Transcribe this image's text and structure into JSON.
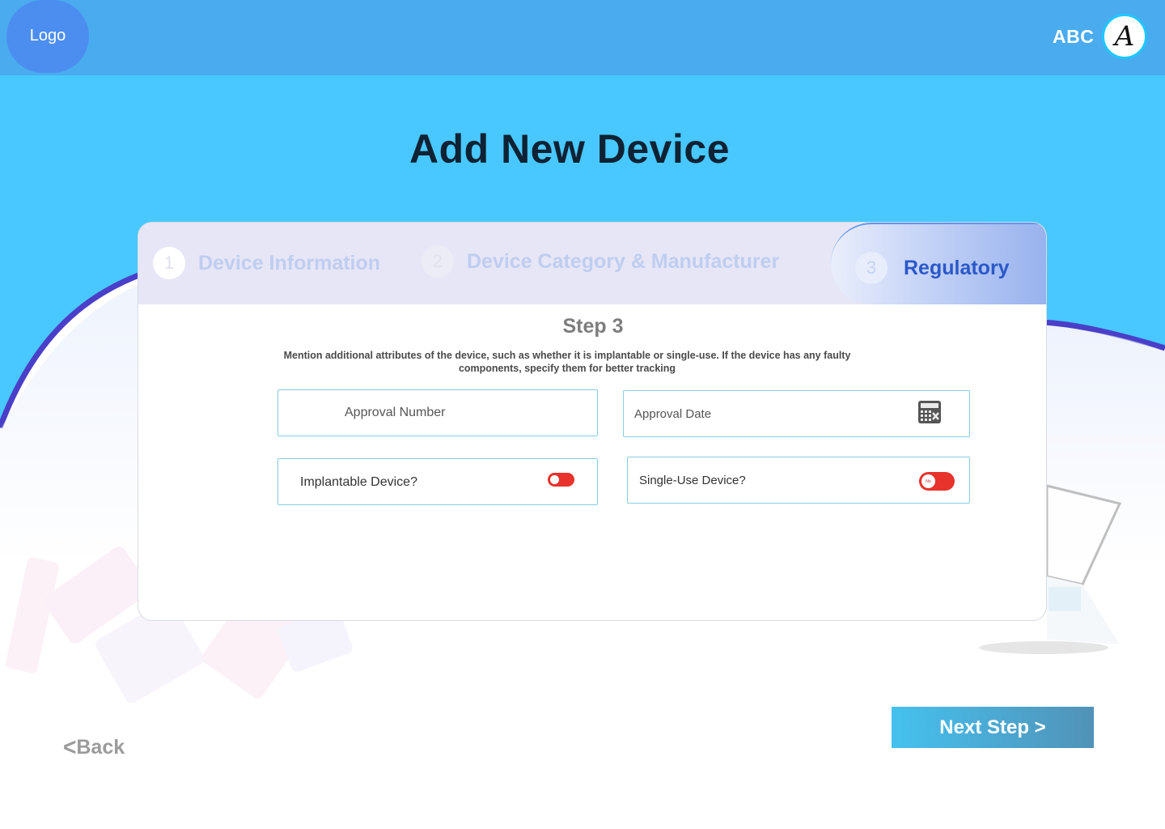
{
  "header": {
    "logo": "Logo",
    "user_name": "ABC",
    "avatar_initial": "A"
  },
  "page_title": "Add New Device",
  "steps": [
    {
      "number": "1",
      "label": "Device Information",
      "state": "inactive"
    },
    {
      "number": "2",
      "label": "Device Category & Manufacturer",
      "state": "inactive"
    },
    {
      "number": "3",
      "label": "Regulatory",
      "state": "active"
    }
  ],
  "form": {
    "heading": "Step 3",
    "description": "Mention additional attributes of the device, such as whether it is implantable or single-use. If the device has any faulty components, specify them for better tracking",
    "approval_number_placeholder": "Approval Number",
    "approval_date_placeholder": "Approval Date",
    "implantable_label": "Implantable Device?",
    "implantable_value": false,
    "single_use_label": "Single-Use Device?",
    "single_use_value": false,
    "single_use_toggle_text": "No"
  },
  "nav": {
    "back_label": "Back",
    "next_label": "Next Step >"
  },
  "colors": {
    "header": "#4aabef",
    "hero": "#48c8fe",
    "accent_wave": "#4a3fc8",
    "toggle_off": "#e8322c",
    "active_step": "#2b58c9"
  }
}
